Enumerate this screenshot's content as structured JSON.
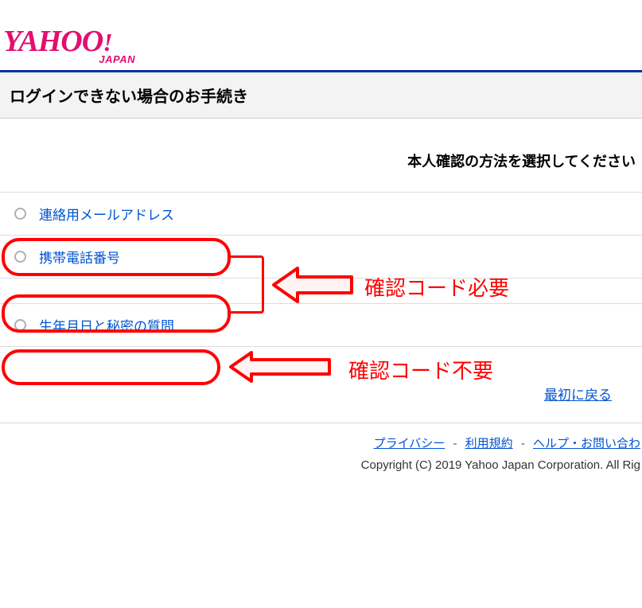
{
  "logo": {
    "main": "YAHOO",
    "bang": "!",
    "sub": "JAPAN"
  },
  "header": {
    "title": "ログインできない場合のお手続き"
  },
  "prompt": "本人確認の方法を選択してください",
  "options": [
    {
      "label": "連絡用メールアドレス"
    },
    {
      "label": "携帯電話番号"
    },
    {
      "label": "生年月日と秘密の質問"
    }
  ],
  "back_link": "最初に戻る",
  "footer": {
    "privacy": "プライバシー",
    "terms": "利用規約",
    "help": "ヘルプ・お問い合わ",
    "sep": "-",
    "copyright": "Copyright (C) 2019 Yahoo Japan Corporation. All Rig"
  },
  "annotations": {
    "code_required": "確認コード必要",
    "code_not_required": "確認コード不要"
  }
}
